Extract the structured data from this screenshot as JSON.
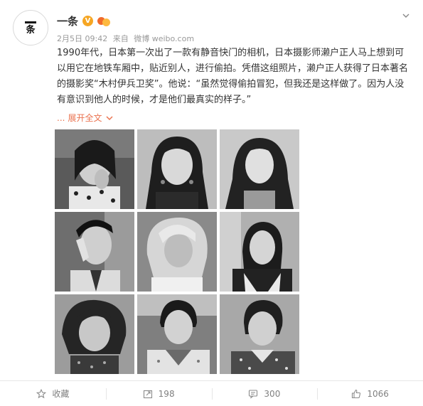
{
  "post": {
    "author": "一条",
    "verified_badge": "V",
    "avatar_text": "条",
    "date": "2月5日 09:42",
    "source_prefix": "来自",
    "source": "微博 weibo.com",
    "paragraph": "1990年代，日本第一次出了一款有静音快门的相机，日本摄影师濑户正人马上想到可以用它在地铁车厢中，贴近别人，进行偷拍。凭借这组照片，濑户正人获得了日本著名的摄影奖“木村伊兵卫奖”。他说：“虽然觉得偷拍冒犯，但我还是这样做了。因为人没有意识到他人的时候，才是他们最真实的样子。”",
    "expand_dots": "...",
    "expand_label": "展开全文"
  },
  "photos": [
    {
      "label": "photo-1"
    },
    {
      "label": "photo-2"
    },
    {
      "label": "photo-3"
    },
    {
      "label": "photo-4"
    },
    {
      "label": "photo-5"
    },
    {
      "label": "photo-6"
    },
    {
      "label": "photo-7"
    },
    {
      "label": "photo-8"
    },
    {
      "label": "photo-9"
    }
  ],
  "footer": {
    "favorite_label": "收藏",
    "repost_count": "198",
    "comment_count": "300",
    "like_count": "1066"
  },
  "colors": {
    "accent": "#eb7350",
    "muted": "#808080",
    "verified": "#f6a623"
  },
  "icons": [
    "chevron-down-icon",
    "star-icon",
    "repost-icon",
    "comment-icon",
    "thumbs-up-icon"
  ]
}
